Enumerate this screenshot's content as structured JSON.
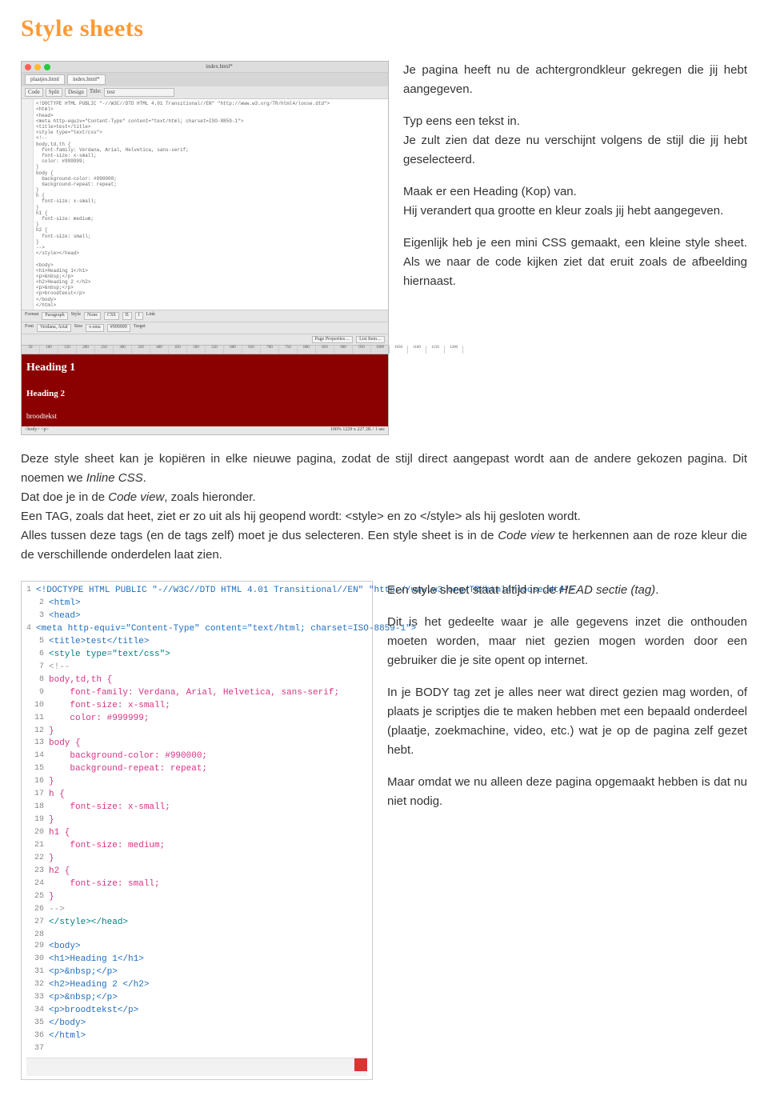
{
  "title": "Style sheets",
  "intro": {
    "p1": "Je pagina heeft nu de achtergrondkleur gekregen die jij hebt aangegeven.",
    "p2a": "Typ eens een tekst in.",
    "p2b": "Je zult zien dat deze nu verschijnt volgens de stijl die jij hebt geselecteerd.",
    "p3a": "Maak er een Heading (Kop) van.",
    "p3b": "Hij verandert qua grootte en kleur zoals jij hebt aangegeven.",
    "p4": "Eigenlijk heb je een mini CSS gemaakt, een kleine style sheet. Als we naar de code kijken ziet dat eruit zoals de afbeelding hiernaast."
  },
  "middle": {
    "s1": "Deze style sheet kan je kopiëren in elke nieuwe pagina, zodat de stijl direct aangepast wordt aan de andere gekozen pagina. Dit noemen we ",
    "s1i": "Inline CSS",
    "s1b": ".",
    "s2": "Dat doe je in de ",
    "s2i": "Code view",
    "s2b": ", zoals hieronder.",
    "s3": "Een TAG, zoals dat heet, ziet er zo uit als hij geopend wordt: <style> en zo </style> als hij gesloten wordt.",
    "s4a": "Alles tussen deze tags (en de tags zelf) moet je dus selecteren. Een style sheet is in de ",
    "s4i": "Code view",
    "s4b": " te herkennen aan de roze kleur die de verschillende onderdelen laat zien."
  },
  "right": {
    "p1a": "Een style sheet staat altijd in de ",
    "p1i": "HEAD sectie (tag)",
    "p1b": ".",
    "p2": "Dit is het gedeelte waar je alle gegevens inzet die onthouden moeten worden, maar niet gezien mogen worden door een gebruiker die je site opent op internet.",
    "p3": "In je BODY tag zet je alles neer wat direct gezien mag worden, of plaats je scriptjes die te maken hebben met een bepaald onderdeel (plaatje, zoekmachine, video, etc.) wat je op de pagina zelf gezet hebt.",
    "p4": "Maar omdat we nu alleen deze pagina opgemaakt hebben is dat nu niet nodig."
  },
  "editor": {
    "titlebar": "index.html*",
    "tabs": [
      "plaatjes.html",
      "index.html*"
    ],
    "toolbar": [
      "Code",
      "Split",
      "Design",
      "Title:",
      "test"
    ],
    "propbar": [
      "Format",
      "Paragraph",
      "Style",
      "None",
      "CSS",
      "B",
      "I",
      "Link",
      "Font",
      "Verdana, Arial",
      "Size",
      "x-sma",
      "#999999",
      "Target",
      "Page Properties…",
      "List Item…"
    ],
    "ruler": [
      "50",
      "100",
      "150",
      "200",
      "250",
      "300",
      "350",
      "400",
      "450",
      "500",
      "550",
      "600",
      "650",
      "700",
      "750",
      "800",
      "850",
      "900",
      "950",
      "1000",
      "1050",
      "1100",
      "1150",
      "1200"
    ],
    "preview": {
      "h1": "Heading 1",
      "h2": "Heading 2",
      "txt": "broodtekst"
    },
    "status": {
      "left": "<body> <p>",
      "right": "100%   1229 x 227  2K / 1 sec"
    },
    "code": "<!DOCTYPE HTML PUBLIC \"-//W3C//DTD HTML 4.01 Transitional//EN\" \"http://www.w3.org/TR/html4/loose.dtd\">\n<html>\n<head>\n<meta http-equiv=\"Content-Type\" content=\"text/html; charset=ISO-8859-1\">\n<title>test</title>\n<style type=\"text/css\">\n<!--\nbody,td,th {\n  font-family: Verdana, Arial, Helvetica, sans-serif;\n  font-size: x-small;\n  color: #999999;\n}\nbody {\n  background-color: #990000;\n  background-repeat: repeat;\n}\nh {\n  font-size: x-small;\n}\nh1 {\n  font-size: medium;\n}\nh2 {\n  font-size: small;\n}\n-->\n</style></head>\n\n<body>\n<h1>Heading 1</h1>\n<p>&nbsp;</p>\n<h2>Heading 2 </h2>\n<p>&nbsp;</p>\n<p>broodtekst</p>\n</body>\n</html>"
  },
  "codelines": [
    {
      "n": "1",
      "c": "<!DOCTYPE HTML PUBLIC \"-//W3C//DTD HTML 4.01 Transitional//EN\" \"http://www.w3.org/TR/html4/loose.dtd\">",
      "cls": "blue"
    },
    {
      "n": "2",
      "c": "<html>",
      "cls": "blue"
    },
    {
      "n": "3",
      "c": "<head>",
      "cls": "blue"
    },
    {
      "n": "4",
      "c": "<meta http-equiv=\"Content-Type\" content=\"text/html; charset=ISO-8859-1\">",
      "cls": "blue"
    },
    {
      "n": "5",
      "c": "<title>test</title>",
      "cls": "blue"
    },
    {
      "n": "6",
      "c": "<style type=\"text/css\">",
      "cls": "teal"
    },
    {
      "n": "7",
      "c": "<!--",
      "cls": "gray"
    },
    {
      "n": "8",
      "c": "body,td,th {",
      "cls": "pink"
    },
    {
      "n": "9",
      "c": "    font-family: Verdana, Arial, Helvetica, sans-serif;",
      "cls": "pink"
    },
    {
      "n": "10",
      "c": "    font-size: x-small;",
      "cls": "pink"
    },
    {
      "n": "11",
      "c": "    color: #999999;",
      "cls": "pink"
    },
    {
      "n": "12",
      "c": "}",
      "cls": "pink"
    },
    {
      "n": "13",
      "c": "body {",
      "cls": "pink"
    },
    {
      "n": "14",
      "c": "    background-color: #990000;",
      "cls": "pink"
    },
    {
      "n": "15",
      "c": "    background-repeat: repeat;",
      "cls": "pink"
    },
    {
      "n": "16",
      "c": "}",
      "cls": "pink"
    },
    {
      "n": "17",
      "c": "h {",
      "cls": "pink"
    },
    {
      "n": "18",
      "c": "    font-size: x-small;",
      "cls": "pink"
    },
    {
      "n": "19",
      "c": "}",
      "cls": "pink"
    },
    {
      "n": "20",
      "c": "h1 {",
      "cls": "pink"
    },
    {
      "n": "21",
      "c": "    font-size: medium;",
      "cls": "pink"
    },
    {
      "n": "22",
      "c": "}",
      "cls": "pink"
    },
    {
      "n": "23",
      "c": "h2 {",
      "cls": "pink"
    },
    {
      "n": "24",
      "c": "    font-size: small;",
      "cls": "pink"
    },
    {
      "n": "25",
      "c": "}",
      "cls": "pink"
    },
    {
      "n": "26",
      "c": "-->",
      "cls": "gray"
    },
    {
      "n": "27",
      "c": "</style></head>",
      "cls": "teal"
    },
    {
      "n": "28",
      "c": "",
      "cls": ""
    },
    {
      "n": "29",
      "c": "<body>",
      "cls": "blue"
    },
    {
      "n": "30",
      "c": "<h1>Heading 1</h1>",
      "cls": "blue"
    },
    {
      "n": "31",
      "c": "<p>&nbsp;</p>",
      "cls": "blue"
    },
    {
      "n": "32",
      "c": "<h2>Heading 2 </h2>",
      "cls": "blue"
    },
    {
      "n": "33",
      "c": "<p>&nbsp;</p>",
      "cls": "blue"
    },
    {
      "n": "34",
      "c": "<p>broodtekst</p>",
      "cls": "blue"
    },
    {
      "n": "35",
      "c": "</body>",
      "cls": "blue"
    },
    {
      "n": "36",
      "c": "</html>",
      "cls": "blue"
    },
    {
      "n": "37",
      "c": "",
      "cls": ""
    }
  ]
}
